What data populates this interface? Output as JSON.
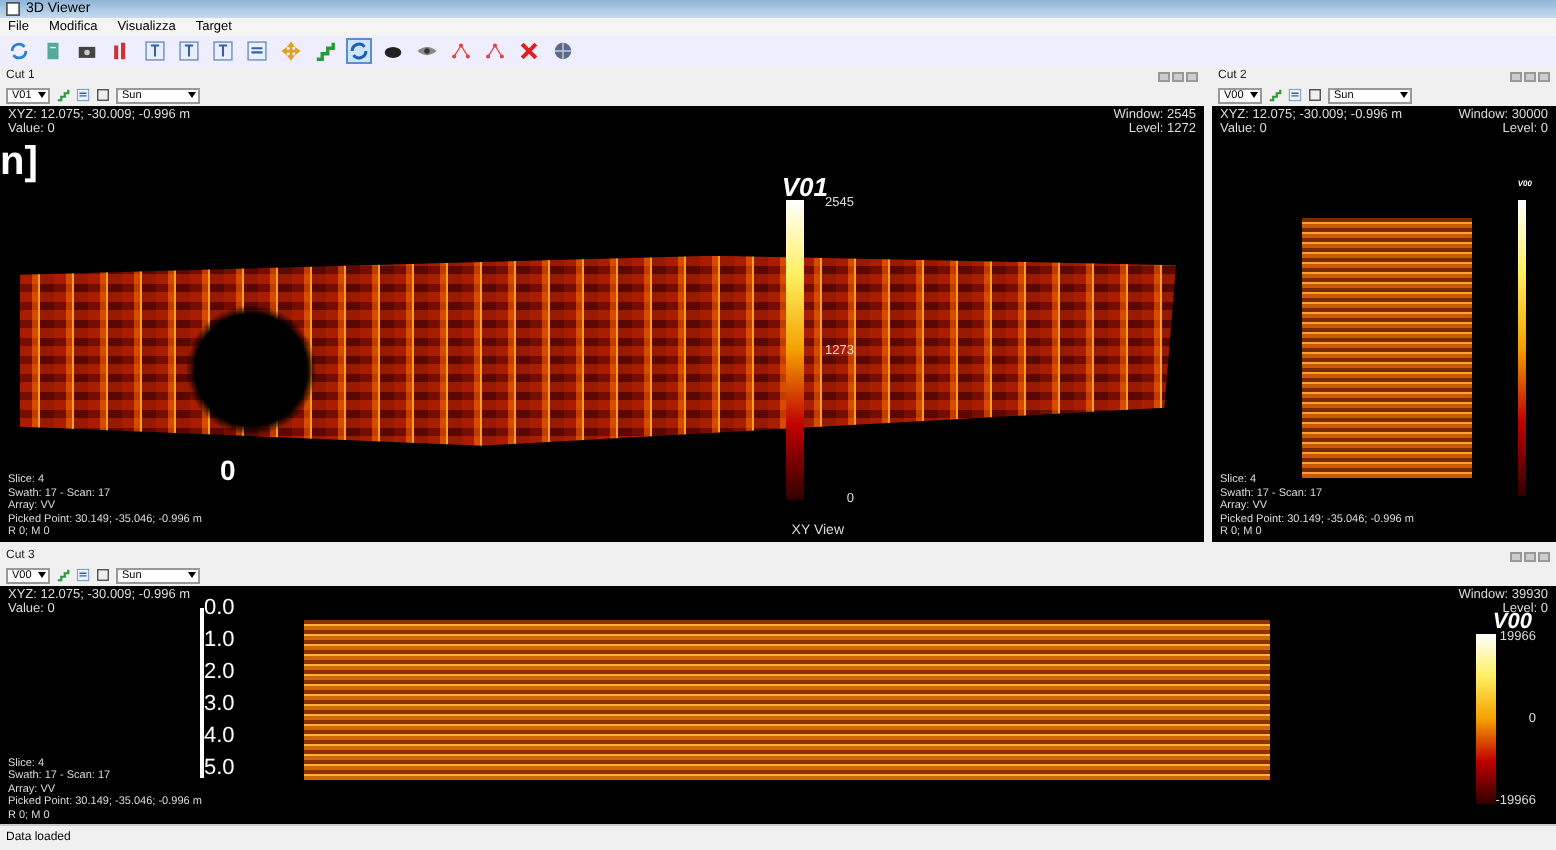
{
  "window": {
    "title": "3D Viewer"
  },
  "menu": [
    "File",
    "Modifica",
    "Visualizza",
    "Target"
  ],
  "toolbar": [
    {
      "kind": "refresh",
      "selected": false
    },
    {
      "kind": "page",
      "selected": false
    },
    {
      "kind": "camera",
      "selected": false
    },
    {
      "kind": "bars",
      "selected": false
    },
    {
      "kind": "tbox",
      "selected": false
    },
    {
      "kind": "tbox",
      "selected": false
    },
    {
      "kind": "tbox",
      "selected": false
    },
    {
      "kind": "lines",
      "selected": false
    },
    {
      "kind": "move",
      "selected": false
    },
    {
      "kind": "stairs",
      "selected": false
    },
    {
      "kind": "rotate",
      "selected": true
    },
    {
      "kind": "disk",
      "selected": false
    },
    {
      "kind": "eye",
      "selected": false
    },
    {
      "kind": "nodes",
      "selected": false
    },
    {
      "kind": "nodes",
      "selected": false
    },
    {
      "kind": "cross",
      "selected": false
    },
    {
      "kind": "globe",
      "selected": false
    }
  ],
  "panels": [
    {
      "kind": "map",
      "title": "Cut 1",
      "layer": "V01",
      "palette": "Sun",
      "xyz": "XYZ:  12.075; -30.009; -0.996 m",
      "value": "Value: 0",
      "window": "Window: 2545",
      "level": "Level: 1272",
      "colorbar": {
        "title": "V01",
        "labels": [
          "2545",
          "1273",
          "0"
        ]
      },
      "info": [
        "Slice: 4",
        "Swath: 17 - Scan: 17",
        "Array: VV",
        "Picked Point:  30.149; -35.046; -0.996 m",
        "R 0; M 0"
      ],
      "view_label": "XY View",
      "axis_labels": [
        "n]",
        "0"
      ]
    },
    {
      "kind": "profile",
      "title": "Cut 2",
      "layer": "V00",
      "palette": "Sun",
      "xyz": "XYZ:  12.075; -30.009; -0.996 m",
      "value": "Value: 0",
      "window": "Window: 30000",
      "level": "Level: 0",
      "colorbar": {
        "title": "V00"
      },
      "info": [
        "Slice: 4",
        "Swath: 17 - Scan: 17",
        "Array: VV",
        "Picked Point:  30.149; -35.046; -0.996 m",
        "R 0; M 0"
      ]
    },
    {
      "kind": "section",
      "title": "Cut 3",
      "layer": "V00",
      "palette": "Sun",
      "xyz": "XYZ:  12.075; -30.009; -0.996 m",
      "value": "Value: 0",
      "window": "Window: 39930",
      "level": "Level: 0",
      "colorbar": {
        "title": "V00",
        "labels": [
          "19966",
          "0",
          "-19966"
        ]
      },
      "info": [
        "Slice: 4",
        "Swath: 17 - Scan: 17",
        "Array: VV",
        "Picked Point:  30.149; -35.046; -0.996 m",
        "R 0; M 0"
      ],
      "depth_ticks": [
        "0.0",
        "1.0",
        "2.0",
        "3.0",
        "4.0",
        "5.0"
      ]
    }
  ],
  "status_bar": "Data loaded"
}
